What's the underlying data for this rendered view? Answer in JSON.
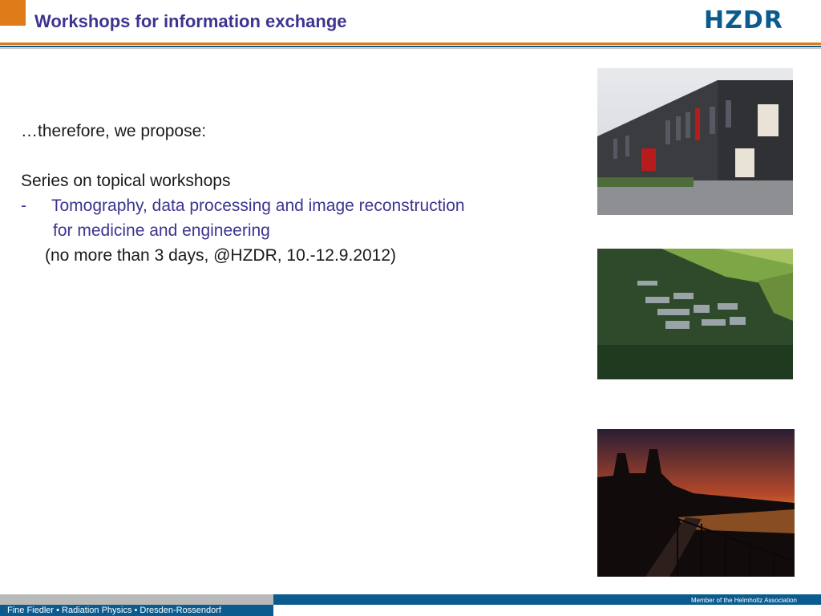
{
  "header": {
    "title": "Workshops for information exchange",
    "logo_text": "HZDR"
  },
  "content": {
    "intro": "…therefore, we propose:",
    "series_heading": "Series on topical workshops",
    "bullet_marker": "-",
    "topic_line1": "Tomography, data processing and image reconstruction",
    "topic_line2": "for medicine and engineering",
    "details": "(no more than 3 days, @HZDR, 10.-12.9.2012)"
  },
  "images": [
    {
      "icon": "building-photo"
    },
    {
      "icon": "aerial-campus-photo"
    },
    {
      "icon": "sunset-skyline-photo"
    }
  ],
  "footer": {
    "author": "Fine Fiedler • Radiation Physics • Dresden-Rossendorf",
    "membership": "Member of the Helmholtz Association"
  },
  "colors": {
    "title": "#3b3590",
    "accent_orange": "#e07b1a",
    "brand_blue": "#0b5b8e",
    "footer_gray": "#b9b9b9"
  }
}
